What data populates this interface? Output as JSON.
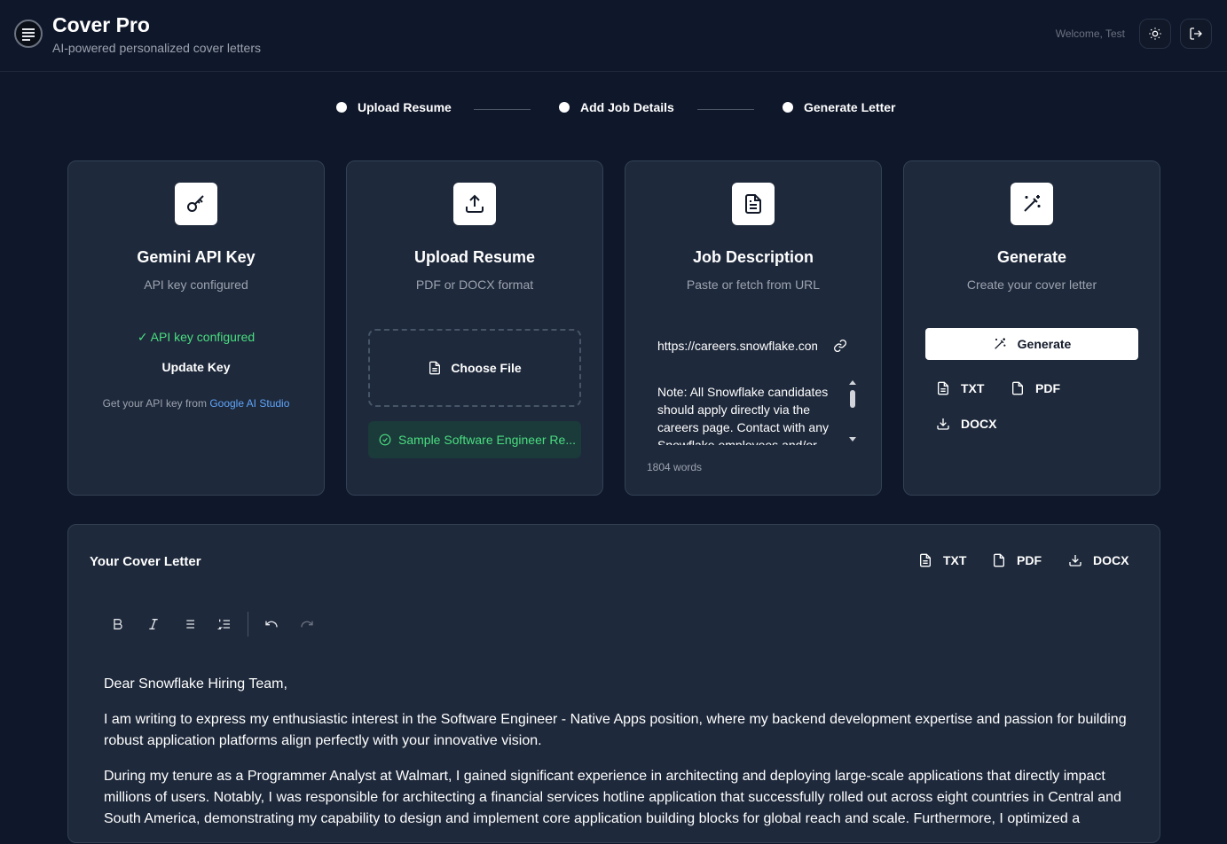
{
  "header": {
    "app_title": "Cover Pro",
    "app_subtitle": "AI-powered personalized cover letters",
    "welcome": "Welcome, Test",
    "theme_icon": "sun-icon",
    "logout_icon": "logout-icon"
  },
  "steps": [
    {
      "label": "Upload Resume"
    },
    {
      "label": "Add Job Details"
    },
    {
      "label": "Generate Letter"
    }
  ],
  "cards": {
    "api": {
      "title": "Gemini API Key",
      "subtitle": "API key configured",
      "status": "✓ API key configured",
      "update_label": "Update Key",
      "help_prefix": "Get your API key from ",
      "help_link": "Google AI Studio",
      "icon": "key-icon"
    },
    "resume": {
      "title": "Upload Resume",
      "subtitle": "PDF or DOCX format",
      "choose_label": "Choose File",
      "file_name": "Sample Software Engineer Re...",
      "icon": "upload-icon"
    },
    "job": {
      "title": "Job Description",
      "subtitle": "Paste or fetch from URL",
      "url_value": "https://careers.snowflake.com",
      "description": "Note: All Snowflake candidates should apply directly via the careers page. Contact with any Snowflake employees and/or",
      "word_count": "1804 words",
      "icon": "document-icon"
    },
    "generate": {
      "title": "Generate",
      "subtitle": "Create your cover letter",
      "button_label": "Generate",
      "txt_label": "TXT",
      "pdf_label": "PDF",
      "docx_label": "DOCX",
      "icon": "magic-wand-icon"
    }
  },
  "letter": {
    "title": "Your Cover Letter",
    "txt_label": "TXT",
    "pdf_label": "PDF",
    "docx_label": "DOCX",
    "paragraphs": [
      "Dear Snowflake Hiring Team,",
      "I am writing to express my enthusiastic interest in the Software Engineer - Native Apps position, where my backend development expertise and passion for building robust application platforms align perfectly with your innovative vision.",
      "During my tenure as a Programmer Analyst at Walmart, I gained significant experience in architecting and deploying large-scale applications that directly impact millions of users. Notably, I was responsible for architecting a financial services hotline application that successfully rolled out across eight countries in Central and South America, demonstrating my capability to design and implement core application building blocks for global reach and scale. Furthermore, I optimized a"
    ]
  }
}
